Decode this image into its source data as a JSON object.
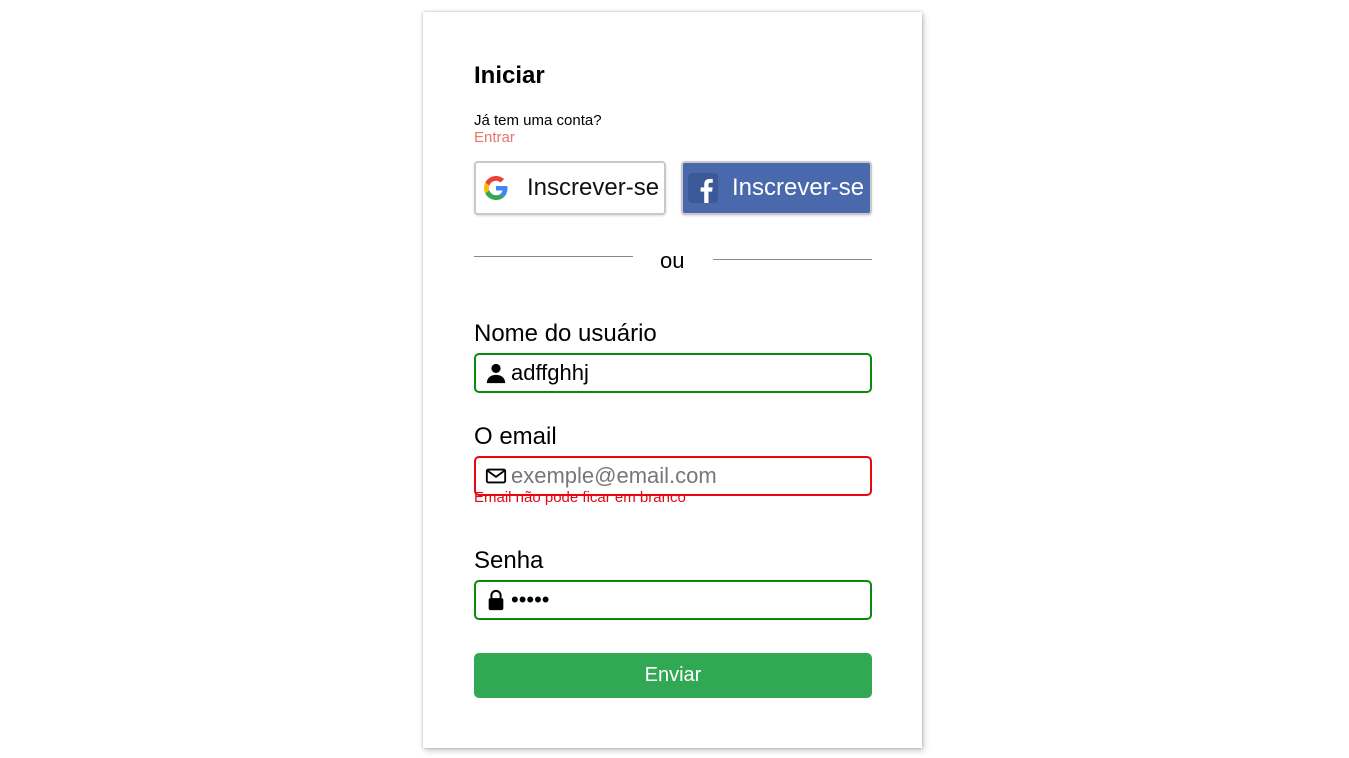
{
  "form": {
    "title": "Iniciar",
    "have_account_text": "Já tem uma conta?",
    "login_link": "Entrar",
    "social": {
      "google_label": "Inscrever-se",
      "google_icon": "google-logo-icon",
      "facebook_label": "Inscrever-se",
      "facebook_icon": "facebook-logo-icon"
    },
    "divider_text": "ou",
    "fields": {
      "username": {
        "label": "Nome do usuário",
        "value": "adffghhj",
        "icon": "user-icon",
        "status": "valid"
      },
      "email": {
        "label": "O email",
        "value": "",
        "placeholder": "exemple@email.com",
        "icon": "envelope-icon",
        "status": "invalid",
        "error": "Email não pode ficar em branco"
      },
      "password": {
        "label": "Senha",
        "value": "•••••",
        "icon": "lock-icon",
        "status": "valid"
      }
    },
    "submit_label": "Enviar"
  },
  "colors": {
    "valid_border": "#0a8a0a",
    "invalid_border": "#e8070f",
    "link": "#e8766b",
    "facebook_bg": "#4a68ac",
    "submit_bg": "#31a853"
  }
}
